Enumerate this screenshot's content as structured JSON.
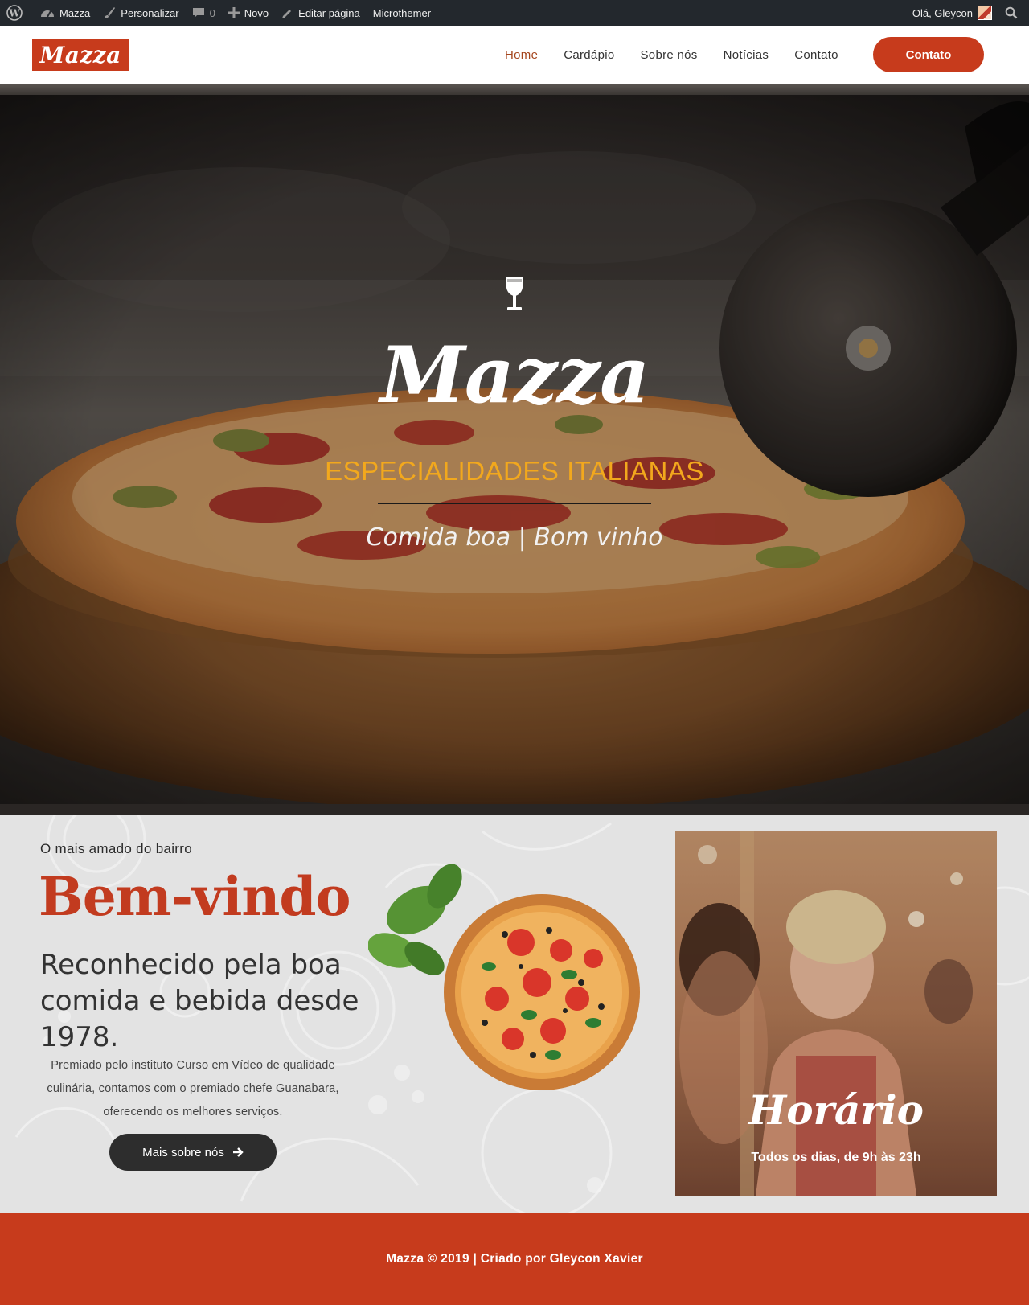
{
  "adminbar": {
    "site_name": "Mazza",
    "customize": "Personalizar",
    "comments_count": "0",
    "new": "Novo",
    "edit_page": "Editar página",
    "microthemer": "Microthemer",
    "greeting": "Olá, Gleycon"
  },
  "header": {
    "logo": "Mazza",
    "nav": [
      "Home",
      "Cardápio",
      "Sobre nós",
      "Notícias",
      "Contato"
    ],
    "active_nav": "Home",
    "cta": "Contato"
  },
  "hero": {
    "icon": "wine-glass-icon",
    "title": "Mazza",
    "subtitle": "ESPECIALIDADES ITALIANAS",
    "tagline": "Comida boa | Bom vinho"
  },
  "welcome": {
    "kicker": "O mais amado do bairro",
    "title": "Bem-vindo",
    "heading": "Reconhecido pela boa comida e bebida desde 1978.",
    "text": "Premiado pelo instituto Curso em Vídeo de qualidade culinária, contamos com o premiado chefe Guanabara, oferecendo os melhores serviços.",
    "button": "Mais sobre nós"
  },
  "hours": {
    "title": "Horário",
    "text": "Todos os dias, de 9h às 23h"
  },
  "footer": {
    "text": "Mazza © 2019 | Criado por Gleycon Xavier"
  },
  "colors": {
    "brand": "#c73b1c",
    "accent_gold": "#f2a81d",
    "admin_bar": "#23282d",
    "dark_button": "#2d2d2d"
  }
}
